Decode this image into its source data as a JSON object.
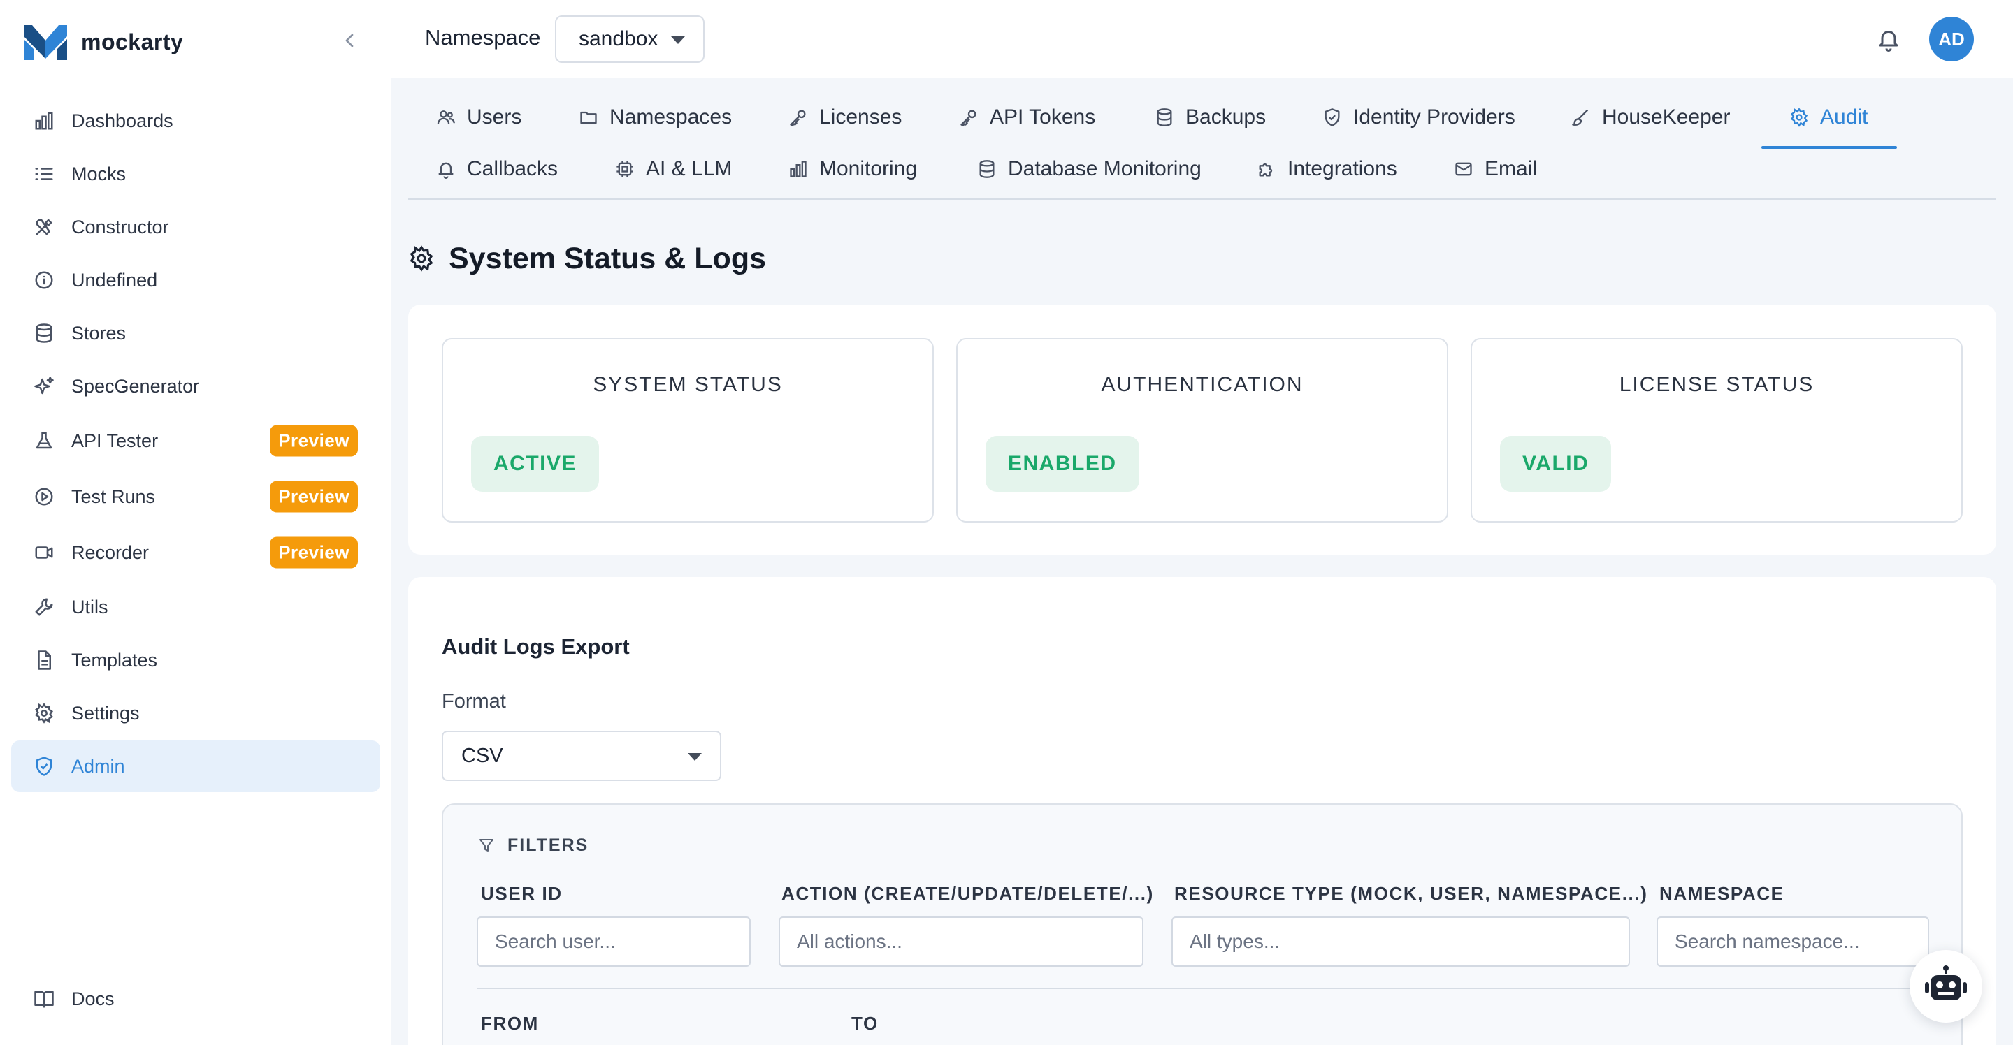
{
  "brand": {
    "name": "mockarty",
    "colors": {
      "primary": "#2f84d6",
      "dark": "#1a4f86"
    }
  },
  "sidebar": {
    "items": [
      {
        "label": "Dashboards",
        "icon": "bar-chart-icon"
      },
      {
        "label": "Mocks",
        "icon": "list-icon"
      },
      {
        "label": "Constructor",
        "icon": "tools-icon"
      },
      {
        "label": "Undefined",
        "icon": "info-icon"
      },
      {
        "label": "Stores",
        "icon": "database-icon"
      },
      {
        "label": "SpecGenerator",
        "icon": "sparkles-icon"
      },
      {
        "label": "API Tester",
        "icon": "flask-icon",
        "badge": "Preview"
      },
      {
        "label": "Test Runs",
        "icon": "play-circle-icon",
        "badge": "Preview"
      },
      {
        "label": "Recorder",
        "icon": "video-icon",
        "badge": "Preview"
      },
      {
        "label": "Utils",
        "icon": "wrench-icon"
      },
      {
        "label": "Templates",
        "icon": "file-icon"
      },
      {
        "label": "Settings",
        "icon": "gear-icon"
      },
      {
        "label": "Admin",
        "icon": "shield-icon",
        "active": true
      }
    ],
    "docs_label": "Docs"
  },
  "topbar": {
    "namespace_label": "Namespace",
    "namespace_value": "sandbox",
    "avatar_initials": "AD"
  },
  "tabs": [
    {
      "label": "Users",
      "icon": "users-icon"
    },
    {
      "label": "Namespaces",
      "icon": "folder-icon"
    },
    {
      "label": "Licenses",
      "icon": "key-icon"
    },
    {
      "label": "API Tokens",
      "icon": "key-icon"
    },
    {
      "label": "Backups",
      "icon": "database-icon"
    },
    {
      "label": "Identity Providers",
      "icon": "shield-icon"
    },
    {
      "label": "HouseKeeper",
      "icon": "brush-icon"
    },
    {
      "label": "Audit",
      "icon": "gear-icon",
      "active": true
    },
    {
      "label": "Callbacks",
      "icon": "bell-icon"
    },
    {
      "label": "AI & LLM",
      "icon": "chip-icon"
    },
    {
      "label": "Monitoring",
      "icon": "bar-chart-icon"
    },
    {
      "label": "Database Monitoring",
      "icon": "database-icon"
    },
    {
      "label": "Integrations",
      "icon": "puzzle-icon"
    },
    {
      "label": "Email",
      "icon": "mail-icon"
    }
  ],
  "page": {
    "title": "System Status & Logs"
  },
  "status_cards": [
    {
      "heading": "SYSTEM STATUS",
      "value": "ACTIVE"
    },
    {
      "heading": "AUTHENTICATION",
      "value": "ENABLED"
    },
    {
      "heading": "LICENSE STATUS",
      "value": "VALID"
    }
  ],
  "status_colors": {
    "pill_bg": "#e4f4ec",
    "pill_text": "#1aa86a"
  },
  "export": {
    "title": "Audit Logs Export",
    "format_label": "Format",
    "format_value": "CSV",
    "filters_label": "FILTERS",
    "filters": [
      {
        "label": "USER ID",
        "placeholder": "Search user..."
      },
      {
        "label": "ACTION (CREATE/UPDATE/DELETE/...)",
        "placeholder": "All actions..."
      },
      {
        "label": "RESOURCE TYPE (MOCK, USER, NAMESPACE...)",
        "placeholder": "All types..."
      },
      {
        "label": "NAMESPACE",
        "placeholder": "Search namespace..."
      }
    ],
    "from_label": "FROM",
    "to_label": "TO"
  },
  "preview_badge_color": "#f59b0b"
}
